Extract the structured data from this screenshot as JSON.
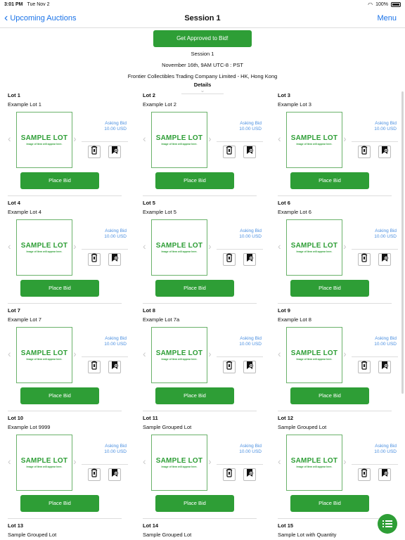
{
  "status": {
    "time": "3:01 PM",
    "date": "Tue Nov 2",
    "battery": "100%"
  },
  "nav": {
    "back_label": "Upcoming Auctions",
    "title": "Session 1",
    "menu_label": "Menu"
  },
  "header": {
    "approve_label": "Get Approved to Bid!",
    "session": "Session 1",
    "date_line": "November 16th, 9AM UTC-8 : PST",
    "company_line": "Frontier Collectibles Trading Company Limited - HK, Hong Kong",
    "details_label": "Details"
  },
  "lots": [
    {
      "num": "Lot 1",
      "name": "Example Lot 1",
      "asking_label": "Asking Bid",
      "asking_value": "10.00 USD",
      "image_title": "SAMPLE LOT",
      "image_caption": "Image of Item will appear here.",
      "bid_label": "Place Bid"
    },
    {
      "num": "Lot 2",
      "name": "Example Lot 2",
      "asking_label": "Asking Bid",
      "asking_value": "10.00 USD",
      "image_title": "SAMPLE LOT",
      "image_caption": "Image of Item will appear here.",
      "bid_label": "Place Bid"
    },
    {
      "num": "Lot 3",
      "name": "Example Lot 3",
      "asking_label": "Asking Bid",
      "asking_value": "10.00 USD",
      "image_title": "SAMPLE LOT",
      "image_caption": "Image of Item will appear here.",
      "bid_label": "Place Bid"
    },
    {
      "num": "Lot 4",
      "name": "Example Lot 4",
      "asking_label": "Asking Bid",
      "asking_value": "10.00 USD",
      "image_title": "SAMPLE LOT",
      "image_caption": "Image of Item will appear here.",
      "bid_label": "Place Bid"
    },
    {
      "num": "Lot 5",
      "name": "Example Lot 5",
      "asking_label": "Asking Bid",
      "asking_value": "10.00 USD",
      "image_title": "SAMPLE LOT",
      "image_caption": "Image of Item will appear here.",
      "bid_label": "Place Bid"
    },
    {
      "num": "Lot 6",
      "name": "Example Lot 6",
      "asking_label": "Asking Bid",
      "asking_value": "10.00 USD",
      "image_title": "SAMPLE LOT",
      "image_caption": "Image of Item will appear here.",
      "bid_label": "Place Bid"
    },
    {
      "num": "Lot 7",
      "name": "Example Lot 7",
      "asking_label": "Asking Bid",
      "asking_value": "10.00 USD",
      "image_title": "SAMPLE LOT",
      "image_caption": "Image of Item will appear here.",
      "bid_label": "Place Bid"
    },
    {
      "num": "Lot 8",
      "name": "Example Lot 7a",
      "asking_label": "Asking Bid",
      "asking_value": "10.00 USD",
      "image_title": "SAMPLE LOT",
      "image_caption": "Image of Item will appear here.",
      "bid_label": "Place Bid"
    },
    {
      "num": "Lot 9",
      "name": "Example Lot 8",
      "asking_label": "Asking Bid",
      "asking_value": "10.00 USD",
      "image_title": "SAMPLE LOT",
      "image_caption": "Image of Item will appear here.",
      "bid_label": "Place Bid"
    },
    {
      "num": "Lot 10",
      "name": "Example Lot 9999",
      "asking_label": "Asking Bid",
      "asking_value": "10.00 USD",
      "image_title": "SAMPLE LOT",
      "image_caption": "Image of Item will appear here.",
      "bid_label": "Place Bid"
    },
    {
      "num": "Lot 11",
      "name": "Sample Grouped Lot",
      "asking_label": "Asking Bid",
      "asking_value": "10.00 USD",
      "image_title": "SAMPLE LOT",
      "image_caption": "Image of Item will appear here.",
      "bid_label": "Place Bid"
    },
    {
      "num": "Lot 12",
      "name": "Sample Grouped Lot",
      "asking_label": "Asking Bid",
      "asking_value": "10.00 USD",
      "image_title": "SAMPLE LOT",
      "image_caption": "Image of Item will appear here.",
      "bid_label": "Place Bid"
    }
  ],
  "partial_lots": [
    {
      "num": "Lot 13",
      "name": "Sample Grouped Lot"
    },
    {
      "num": "Lot 14",
      "name": "Sample Grouped Lot"
    },
    {
      "num": "Lot 15",
      "name": "Sample Lot with Quantity"
    }
  ],
  "icons": {
    "back": "chevron-left-icon",
    "watch": "remote-watch-icon",
    "save": "bookmark-add-icon",
    "list": "list-icon",
    "prev": "chevron-left-icon",
    "next": "chevron-right-icon"
  },
  "colors": {
    "accent": "#2e9e36",
    "link": "#1a73e8",
    "asking": "#4a8fe0"
  }
}
